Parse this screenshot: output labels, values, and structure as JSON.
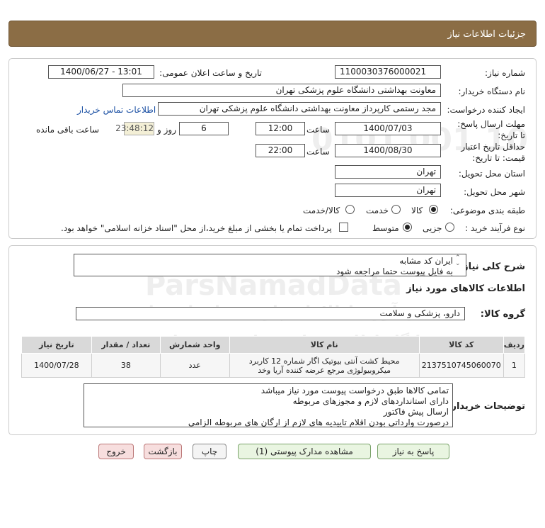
{
  "header": {
    "title": "جزئیات اطلاعات نیاز"
  },
  "form": {
    "need_number_label": "شماره نیاز:",
    "need_number": "1100030376000021",
    "announce_label": "تاریخ و ساعت اعلان عمومی:",
    "announce_value": "1400/06/27 - 13:01",
    "buyer_org_label": "نام دستگاه خریدار:",
    "buyer_org": "معاونت بهداشتی دانشگاه علوم پزشکی تهران",
    "requester_label": "ایجاد کننده درخواست:",
    "requester": "مجد رستمی کارپرداز معاونت بهداشتی دانشگاه علوم پزشکی تهران",
    "contact_link": "اطلاعات تماس خریدار",
    "reply_deadline_label": "مهلت ارسال پاسخ: تا تاریخ:",
    "reply_date": "1400/07/03",
    "time_label": "ساعت",
    "reply_time": "12:00",
    "days_value": "6",
    "days_label": "روز و",
    "remaining_time": "23:48:12",
    "remaining_label": "ساعت باقی مانده",
    "validity_label": "حداقل تاریخ اعتبار قیمت: تا تاریخ:",
    "validity_date": "1400/08/30",
    "validity_time": "22:00",
    "province_label": "استان محل تحویل:",
    "province": "تهران",
    "city_label": "شهر محل تحویل:",
    "city": "تهران",
    "category_label": "طبقه بندی موضوعی:",
    "category_options": [
      "کالا",
      "خدمت",
      "کالا/خدمت"
    ],
    "category_selected": "کالا",
    "process_label": "نوع فرآیند خرید :",
    "process_options": [
      "جزیی",
      "متوسط"
    ],
    "process_selected": "متوسط",
    "payment_note": "پرداخت تمام یا بخشی از مبلغ خرید،از محل \"اسناد خزانه اسلامی\" خواهد بود."
  },
  "description": {
    "label": "شرح کلی نیاز:",
    "lines": [
      "ایران کد مشابه",
      "به فایل پیوست حتما مراجعه شود"
    ]
  },
  "goods": {
    "section_title": "اطلاعات کالاهای مورد نیاز",
    "group_label": "گروه کالا:",
    "group_value": "دارو، پزشکی و سلامت",
    "columns": [
      "ردیف",
      "کد کالا",
      "نام کالا",
      "واحد شمارش",
      "تعداد / مقدار",
      "تاریخ نیاز"
    ],
    "rows": [
      {
        "index": "1",
        "code": "2137510745060070",
        "name": "محیط کشت آنتی بیوتیک اگار شماره 12 کاربرد میکروبیولوژی مرجع عرضه کننده آریا وخد",
        "unit": "عدد",
        "quantity": "38",
        "date": "1400/07/28"
      }
    ]
  },
  "buyer_notes": {
    "label": "توضیحات خریدار:",
    "lines": [
      "تمامی کالاها طبق درخواست پیوست مورد نیاز میباشد",
      "دارای استانداردهای لازم و مجوزهای مربوطه",
      "ارسال پیش فاکتور",
      "درصورت وارداتی بودن اقلام تاییدیه های لازم از ارگان های مربوطه الزامی"
    ]
  },
  "buttons": {
    "reply": "پاسخ به نیاز",
    "attachments": "مشاهده مدارک پیوستی (1)",
    "print": "چاپ",
    "back": "بازگشت",
    "exit": "خروج"
  },
  "watermark": {
    "brand": "ParsNamadData",
    "line1": "پایگاه اطلاع رسانی مناقصه و مزایده",
    "line2": "فن آوری اطلاعات پارس نماد داده ها",
    "phone": "۰۲۱-۸۸۳۴۹۶۷۰",
    "digits": "0101 001 10"
  },
  "colors": {
    "header_bg": "#8b6d45",
    "link": "#1a4fa3",
    "timer_bg": "#f3efd6"
  }
}
